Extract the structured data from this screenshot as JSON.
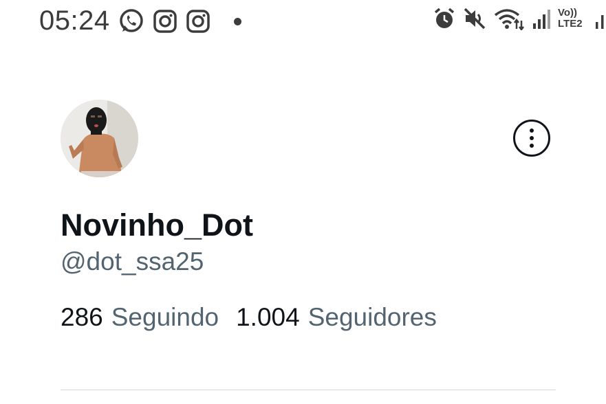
{
  "status_bar": {
    "time": "05:24",
    "left_icons": [
      "whatsapp-icon",
      "instagram-icon",
      "instagram-icon"
    ],
    "right_icons": [
      "alarm-icon",
      "mute-icon",
      "wifi-icon",
      "signal-icon",
      "volte-label",
      "signal-icon"
    ],
    "volte_top": "Vo))",
    "volte_bottom": "LTE2"
  },
  "profile": {
    "display_name": "Novinho_Dot",
    "handle": "@dot_ssa25",
    "following_count": "286",
    "following_label": "Seguindo",
    "followers_count": "1.004",
    "followers_label": "Seguidores"
  },
  "colors": {
    "primary_text": "#0f1419",
    "secondary_text": "#536471",
    "divider": "#cfd9de",
    "status_bar": "#3c3c3c"
  }
}
